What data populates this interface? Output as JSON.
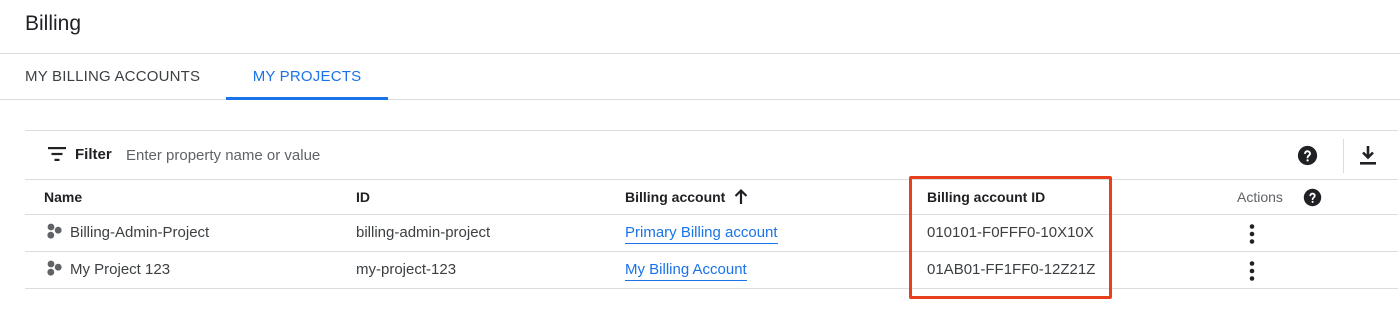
{
  "header": {
    "title": "Billing"
  },
  "tabs": [
    {
      "label": "MY BILLING ACCOUNTS",
      "active": false
    },
    {
      "label": "MY PROJECTS",
      "active": true
    }
  ],
  "filter": {
    "label": "Filter",
    "placeholder": "Enter property name or value",
    "icon": "filter-icon"
  },
  "toolbar": {
    "help_icon": "help-icon",
    "download_icon": "download-icon"
  },
  "table": {
    "columns": {
      "name": "Name",
      "id": "ID",
      "billing_account": "Billing account",
      "billing_account_sort": "ascending",
      "billing_account_id": "Billing account ID",
      "actions": "Actions"
    },
    "rows": [
      {
        "name": "Billing-Admin-Project",
        "id": "billing-admin-project",
        "billing_account": "Primary Billing account",
        "billing_account_id": "010101-F0FFF0-10X10X"
      },
      {
        "name": "My Project 123",
        "id": "my-project-123",
        "billing_account": "My Billing Account",
        "billing_account_id": "01AB01-FF1FF0-12Z21Z"
      }
    ]
  },
  "colors": {
    "accent": "#1a73e8",
    "highlight": "#e8401c",
    "divider": "#dadce0",
    "text": "#202124"
  }
}
